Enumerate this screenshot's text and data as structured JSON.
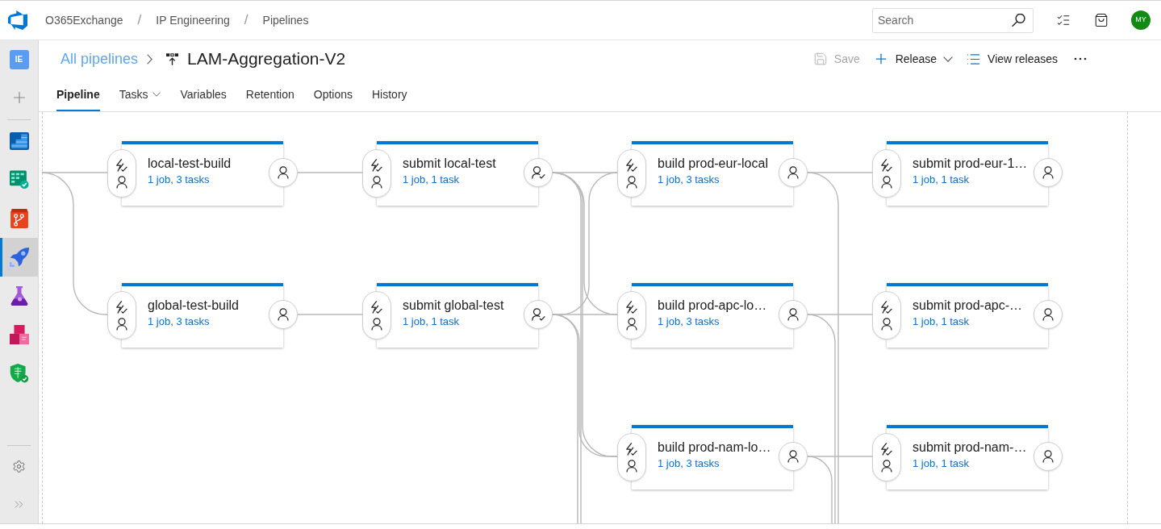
{
  "top_bar": {
    "breadcrumbs": [
      {
        "kind": "link",
        "text": "O365Exchange"
      },
      {
        "kind": "separator",
        "text": "/"
      },
      {
        "kind": "link",
        "text": "IP Engineering"
      },
      {
        "kind": "separator",
        "text": "/"
      },
      {
        "kind": "link",
        "text": "Pipelines"
      }
    ],
    "search": {
      "placeholder": "Search"
    },
    "avatar": {
      "initials": "MY"
    }
  },
  "sidebar": {
    "project": "IE",
    "items": [
      {
        "kind": "chart",
        "selected": false
      },
      {
        "kind": "board",
        "selected": false
      },
      {
        "kind": "branch",
        "selected": false
      },
      {
        "kind": "rocket",
        "selected": true
      },
      {
        "kind": "flask",
        "selected": false
      },
      {
        "kind": "boxes",
        "selected": false
      },
      {
        "kind": "shield",
        "selected": false
      }
    ]
  },
  "header": {
    "back_link": "All pipelines",
    "title": "LAM-Aggregation-V2",
    "actions": [
      {
        "kind": "save",
        "label": "Save",
        "disabled": true,
        "dropdown": false
      },
      {
        "kind": "create",
        "label": "Release",
        "disabled": false,
        "dropdown": true
      },
      {
        "kind": "list",
        "label": "View releases",
        "disabled": false,
        "dropdown": false
      }
    ]
  },
  "tabs": [
    {
      "label": "Pipeline",
      "selected": true,
      "dropdown": false
    },
    {
      "label": "Tasks",
      "selected": false,
      "dropdown": true
    },
    {
      "label": "Variables",
      "selected": false,
      "dropdown": false
    },
    {
      "label": "Retention",
      "selected": false,
      "dropdown": false
    },
    {
      "label": "Options",
      "selected": false,
      "dropdown": false
    },
    {
      "label": "History",
      "selected": false,
      "dropdown": false
    }
  ],
  "stages": {
    "columns": [
      {
        "stages": [
          {
            "name": "local-test-build",
            "summary": "1 job, 3 tasks",
            "post_approvals": false
          },
          {
            "name": "global-test-build",
            "summary": "1 job, 3 tasks",
            "post_approvals": false
          }
        ]
      },
      {
        "stages": [
          {
            "name": "submit local-test",
            "summary": "1 job, 1 task",
            "post_approvals": true
          },
          {
            "name": "submit global-test",
            "summary": "1 job, 1 task",
            "post_approvals": true
          }
        ]
      },
      {
        "stages": [
          {
            "name": "build prod-eur-local",
            "summary": "1 job, 3 tasks",
            "post_approvals": false
          },
          {
            "name": "build prod-apc-lo…",
            "summary": "1 job, 3 tasks",
            "post_approvals": false
          },
          {
            "name": "build prod-nam-lo…",
            "summary": "1 job, 3 tasks",
            "post_approvals": false
          }
        ]
      },
      {
        "stages": [
          {
            "name": "submit prod-eur-1…",
            "summary": "1 job, 1 task",
            "post_approvals": false
          },
          {
            "name": "submit prod-apc-…",
            "summary": "1 job, 1 task",
            "post_approvals": false
          },
          {
            "name": "submit prod-nam-…",
            "summary": "1 job, 1 task",
            "post_approvals": false
          }
        ]
      }
    ]
  }
}
